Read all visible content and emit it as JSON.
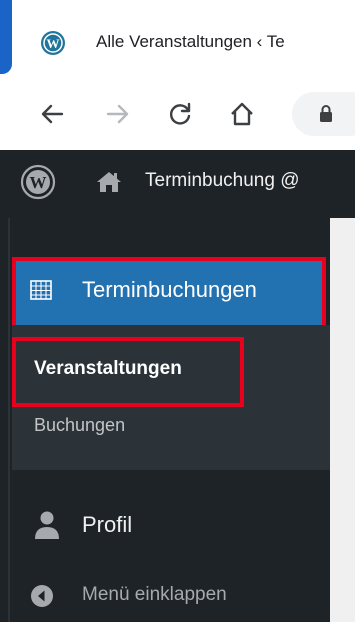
{
  "browser": {
    "tab_title": "Alle Veranstaltungen ‹ Te",
    "icons": [
      "wordpress-icon",
      "back-arrow-icon",
      "forward-arrow-icon",
      "reload-icon",
      "home-icon",
      "lock-icon"
    ]
  },
  "admin_bar": {
    "site_name": "Terminbuchung @"
  },
  "sidebar": {
    "active_menu": {
      "label": "Terminbuchungen",
      "icon": "calendar-grid-icon"
    },
    "submenu": [
      {
        "label": "Veranstaltungen",
        "active": true
      },
      {
        "label": "Buchungen",
        "active": false
      }
    ],
    "profile_label": "Profil",
    "collapse_label": "Menü einklappen"
  },
  "colors": {
    "admin_bg": "#1d2327",
    "submenu_bg": "#2c3338",
    "active_blue": "#2271b1",
    "highlight_red": "#e8001c"
  }
}
